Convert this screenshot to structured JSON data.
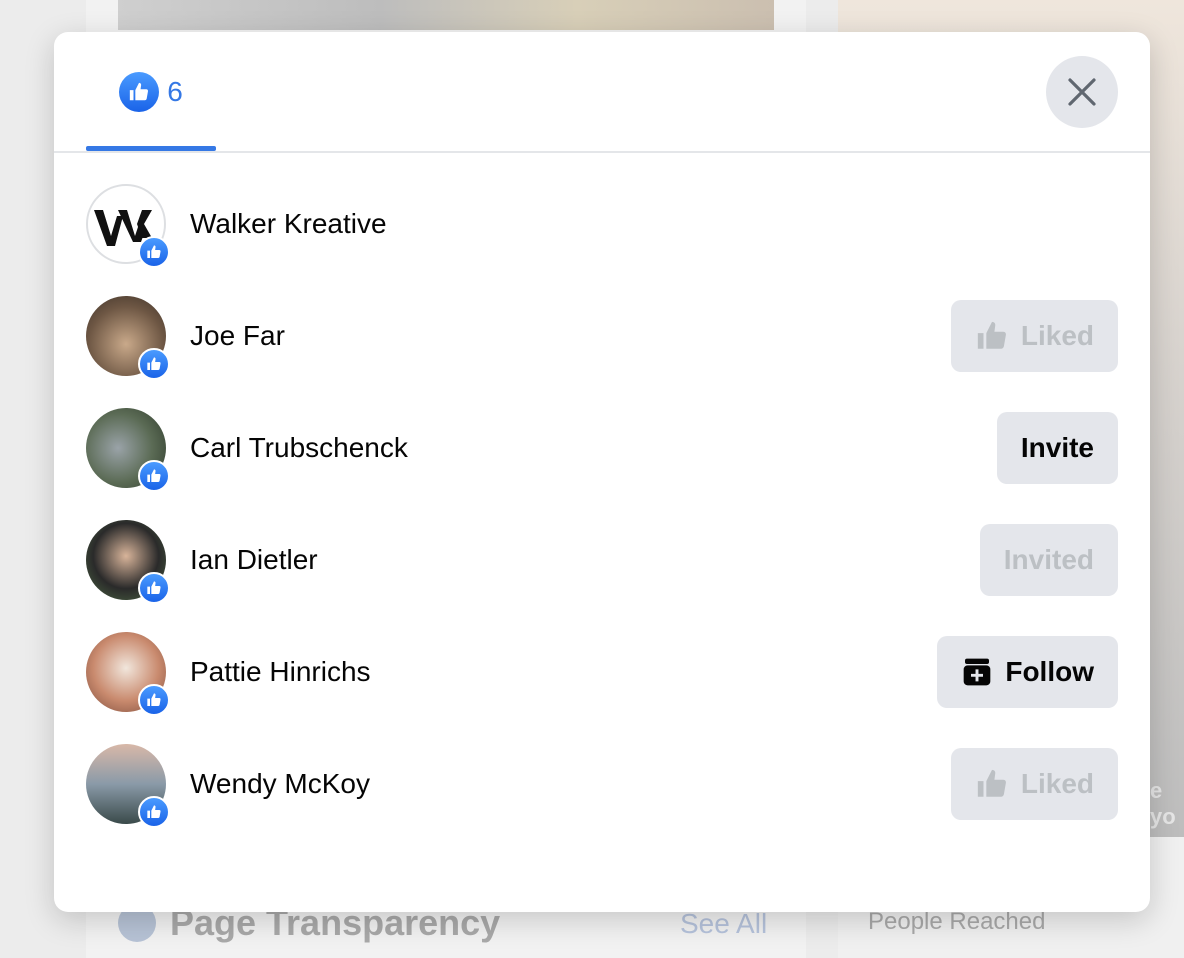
{
  "background": {
    "section_title": "Page Transparency",
    "see_all": "See All",
    "people_reached": "People Reached",
    "partial_text": "e yo"
  },
  "dialog": {
    "tab": {
      "icon": "like-icon",
      "count": "6"
    },
    "close_icon": "close-icon",
    "accent_color": "#3578e5",
    "people": [
      {
        "name": "Walker Kreative",
        "action": null
      },
      {
        "name": "Joe Far",
        "action": {
          "label": "Liked",
          "icon": "thumbs-up-icon",
          "disabled": true
        }
      },
      {
        "name": "Carl Trubschenck",
        "action": {
          "label": "Invite",
          "icon": null,
          "disabled": false
        }
      },
      {
        "name": "Ian Dietler",
        "action": {
          "label": "Invited",
          "icon": null,
          "disabled": true
        }
      },
      {
        "name": "Pattie Hinrichs",
        "action": {
          "label": "Follow",
          "icon": "follow-inbox-plus-icon",
          "disabled": false
        }
      },
      {
        "name": "Wendy McKoy",
        "action": {
          "label": "Liked",
          "icon": "thumbs-up-icon",
          "disabled": true
        }
      }
    ]
  }
}
